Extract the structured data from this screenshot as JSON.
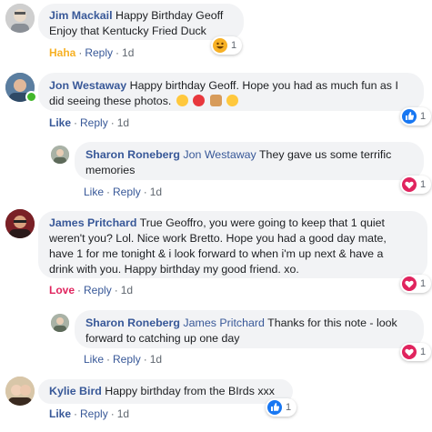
{
  "comments": [
    {
      "author": "Jim Mackail",
      "text_line1": "Happy Birthday Geoff",
      "text_line2": "Enjoy that Kentucky Fried Duck",
      "reaction_action": "Haha",
      "reply": "Reply",
      "time": "1d",
      "reaction_count": "1",
      "reaction_icon": "haha-reaction-icon"
    },
    {
      "author": "Jon Westaway",
      "text_line1": "Happy birthday Geoff. Hope you had as much fun as I",
      "text_line2": "did seeing these photos.",
      "reaction_action": "Like",
      "reply": "Reply",
      "time": "1d",
      "reaction_count": "1",
      "reaction_icon": "like-reaction-icon"
    },
    {
      "author": "Sharon Roneberg",
      "mention": "Jon Westaway",
      "text_line1": "They gave us some terrific",
      "text_line2": "memories",
      "reaction_action": "Like",
      "reply": "Reply",
      "time": "1d",
      "reaction_count": "1",
      "reaction_icon": "love-reaction-icon"
    },
    {
      "author": "James Pritchard",
      "text_line1": "True Geoffro, you were going to keep that 1 quiet",
      "text_line2": "weren't you? Lol. Nice work Bretto. Hope you had a good day mate,",
      "text_line3": "have 1 for me tonight & i look forward to when i'm up next & have a",
      "text_line4": "drink with you. Happy birthday my good friend. xo.",
      "reaction_action": "Love",
      "reply": "Reply",
      "time": "1d",
      "reaction_count": "1",
      "reaction_icon": "love-reaction-icon"
    },
    {
      "author": "Sharon Roneberg",
      "mention": "James Pritchard",
      "text_line1": "Thanks for this note - look",
      "text_line2": "forward to catching up one day",
      "reaction_action": "Like",
      "reply": "Reply",
      "time": "1d",
      "reaction_count": "1",
      "reaction_icon": "love-reaction-icon"
    },
    {
      "author": "Kylie Bird",
      "text_line1": "Happy birthday from the BIrds xxx",
      "reaction_action": "Like",
      "reply": "Reply",
      "time": "1d",
      "reaction_count": "1",
      "reaction_icon": "like-reaction-icon"
    }
  ],
  "separator": "·",
  "colors": {
    "link": "#385898",
    "haha": "#f7b125",
    "love": "#e0245e",
    "like": "#1877f2",
    "bubble": "#f2f3f5"
  }
}
